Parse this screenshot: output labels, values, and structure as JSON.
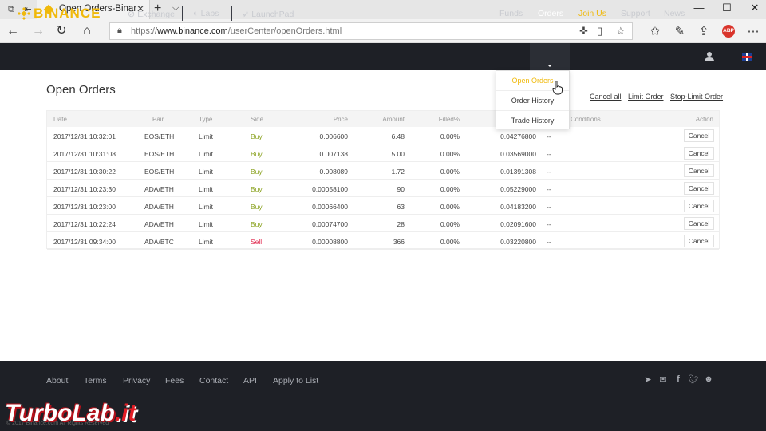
{
  "browser": {
    "tab_title": "Open Orders-Binance.com",
    "tab_close": "✕",
    "new_tab": "+",
    "tab_menu": "⌵",
    "url_prefix": "https://",
    "url_domain": "www.binance.com",
    "url_path": "/userCenter/openOrders.html",
    "abp_label": "ABP",
    "window_controls": [
      "—",
      "☐",
      "✕"
    ]
  },
  "header": {
    "logo": "BINANCE",
    "nav_left": [
      {
        "label": "Exchange",
        "icon": "exchange-icon"
      },
      {
        "label": "Labs",
        "icon": "labs-icon"
      },
      {
        "label": "LaunchPad",
        "icon": "rocket-icon"
      }
    ],
    "nav_right": {
      "funds": "Funds",
      "orders": "Orders",
      "join_us": "Join Us",
      "support": "Support",
      "news": "News"
    }
  },
  "dropdown": {
    "items": [
      "Open Orders",
      "Order History",
      "Trade History"
    ],
    "active_index": 0
  },
  "main": {
    "title": "Open Orders",
    "actions": [
      "Cancel all",
      "Limit Order",
      "Stop-Limit Order"
    ],
    "columns": {
      "date": "Date",
      "pair": "Pair",
      "type": "Type",
      "side": "Side",
      "price": "Price",
      "amount": "Amount",
      "filled": "Filled%",
      "conditions": "Conditions",
      "action": "Action"
    },
    "rows": [
      {
        "date": "2017/12/31 10:32:01",
        "pair": "EOS/ETH",
        "type": "Limit",
        "side": "Buy",
        "price": "0.006600",
        "amount": "6.48",
        "filled": "0.00%",
        "total": "0.04276800",
        "conditions": "--",
        "action": "Cancel"
      },
      {
        "date": "2017/12/31 10:31:08",
        "pair": "EOS/ETH",
        "type": "Limit",
        "side": "Buy",
        "price": "0.007138",
        "amount": "5.00",
        "filled": "0.00%",
        "total": "0.03569000",
        "conditions": "--",
        "action": "Cancel"
      },
      {
        "date": "2017/12/31 10:30:22",
        "pair": "EOS/ETH",
        "type": "Limit",
        "side": "Buy",
        "price": "0.008089",
        "amount": "1.72",
        "filled": "0.00%",
        "total": "0.01391308",
        "conditions": "--",
        "action": "Cancel"
      },
      {
        "date": "2017/12/31 10:23:30",
        "pair": "ADA/ETH",
        "type": "Limit",
        "side": "Buy",
        "price": "0.00058100",
        "amount": "90",
        "filled": "0.00%",
        "total": "0.05229000",
        "conditions": "--",
        "action": "Cancel"
      },
      {
        "date": "2017/12/31 10:23:00",
        "pair": "ADA/ETH",
        "type": "Limit",
        "side": "Buy",
        "price": "0.00066400",
        "amount": "63",
        "filled": "0.00%",
        "total": "0.04183200",
        "conditions": "--",
        "action": "Cancel"
      },
      {
        "date": "2017/12/31 10:22:24",
        "pair": "ADA/ETH",
        "type": "Limit",
        "side": "Buy",
        "price": "0.00074700",
        "amount": "28",
        "filled": "0.00%",
        "total": "0.02091600",
        "conditions": "--",
        "action": "Cancel"
      },
      {
        "date": "2017/12/31 09:34:00",
        "pair": "ADA/BTC",
        "type": "Limit",
        "side": "Sell",
        "price": "0.00008800",
        "amount": "366",
        "filled": "0.00%",
        "total": "0.03220800",
        "conditions": "--",
        "action": "Cancel"
      }
    ]
  },
  "footer": {
    "links": [
      "About",
      "Terms",
      "Privacy",
      "Fees",
      "Contact",
      "API",
      "Apply to List"
    ],
    "social_icons": [
      "telegram-icon",
      "mail-icon",
      "facebook-icon",
      "twitter-icon",
      "reddit-icon"
    ]
  },
  "watermark": {
    "brand_main": "TurboLab",
    "brand_suffix": ".it",
    "copyright": "© 2017 Binance.com All Rights Reserved"
  },
  "colors": {
    "brand_yellow": "#f0b90b",
    "header_bg": "#1e2026",
    "buy_green": "#8aa21f",
    "sell_red": "#e0264b"
  }
}
